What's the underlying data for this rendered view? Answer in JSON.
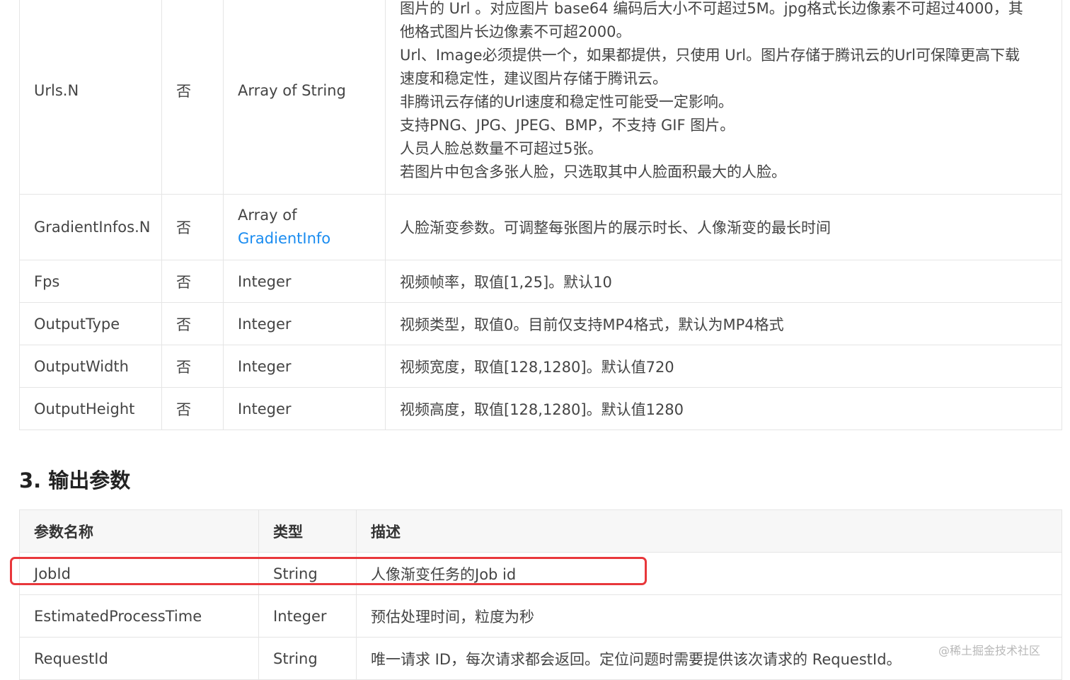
{
  "input_rows": [
    {
      "name": "Urls.N",
      "required": "否",
      "type_text": "Array of String",
      "type_link": "",
      "desc": [
        "图片的 Url 。对应图片 base64 编码后大小不可超过5M。jpg格式长边像素不可超过4000，其",
        "他格式图片长边像素不可超2000。",
        "Url、Image必须提供一个，如果都提供，只使用 Url。图片存储于腾讯云的Url可保障更高下载",
        "速度和稳定性，建议图片存储于腾讯云。",
        "非腾讯云存储的Url速度和稳定性可能受一定影响。",
        "支持PNG、JPG、JPEG、BMP，不支持 GIF 图片。",
        "人员人脸总数量不可超过5张。",
        "若图片中包含多张人脸，只选取其中人脸面积最大的人脸。"
      ]
    },
    {
      "name": "GradientInfos.N",
      "required": "否",
      "type_text": "Array of",
      "type_link": "GradientInfo",
      "desc": [
        "人脸渐变参数。可调整每张图片的展示时长、人像渐变的最长时间"
      ]
    },
    {
      "name": "Fps",
      "required": "否",
      "type_text": "Integer",
      "type_link": "",
      "desc": [
        "视频帧率，取值[1,25]。默认10"
      ]
    },
    {
      "name": "OutputType",
      "required": "否",
      "type_text": "Integer",
      "type_link": "",
      "desc": [
        "视频类型，取值0。目前仅支持MP4格式，默认为MP4格式"
      ]
    },
    {
      "name": "OutputWidth",
      "required": "否",
      "type_text": "Integer",
      "type_link": "",
      "desc": [
        "视频宽度，取值[128,1280]。默认值720"
      ]
    },
    {
      "name": "OutputHeight",
      "required": "否",
      "type_text": "Integer",
      "type_link": "",
      "desc": [
        "视频高度，取值[128,1280]。默认值1280"
      ]
    }
  ],
  "output_section": {
    "title": "3. 输出参数",
    "headers": [
      "参数名称",
      "类型",
      "描述"
    ],
    "rows": [
      {
        "name": "JobId",
        "type": "String",
        "desc": "人像渐变任务的Job id",
        "highlighted": true
      },
      {
        "name": "EstimatedProcessTime",
        "type": "Integer",
        "desc": "预估处理时间，粒度为秒",
        "highlighted": false
      },
      {
        "name": "RequestId",
        "type": "String",
        "desc": "唯一请求 ID，每次请求都会返回。定位问题时需要提供该次请求的 RequestId。",
        "highlighted": false
      }
    ]
  },
  "watermark": "@稀土掘金技术社区",
  "colors": {
    "highlight": "#e8373b",
    "link": "#1a8cf0",
    "header_bg": "#f7f7f7",
    "border": "#e5e5e5"
  }
}
